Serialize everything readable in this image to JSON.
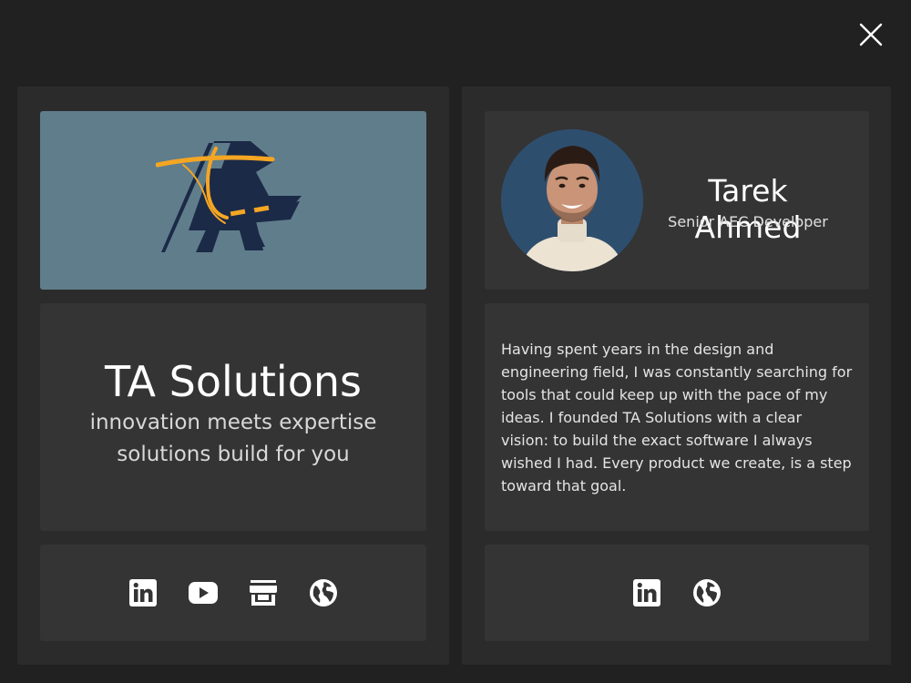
{
  "window": {
    "close_icon": "close-icon"
  },
  "company": {
    "logo_icon": "ta-solutions-logo",
    "logo_text": "TA",
    "name": "TA Solutions",
    "tagline_line1": "innovation meets expertise",
    "tagline_line2": "solutions build for you",
    "links": [
      {
        "icon": "linkedin-icon"
      },
      {
        "icon": "youtube-icon"
      },
      {
        "icon": "store-icon"
      },
      {
        "icon": "globe-icon"
      }
    ]
  },
  "person": {
    "name": "Tarek Ahmed",
    "role": "Senior AEC Developer",
    "bio": "Having spent years in the design and engineering field, I was constantly searching for tools that could keep up with the pace of my ideas. I founded TA Solutions with a clear vision: to build the exact software I always wished I had. Every product we create, is a step toward that goal.",
    "links": [
      {
        "icon": "linkedin-icon"
      },
      {
        "icon": "globe-icon"
      }
    ]
  },
  "colors": {
    "background": "#212121",
    "panel": "#2b2b2b",
    "card": "#343434",
    "logo_bg": "#607d8b",
    "logo_navy": "#1b2a47",
    "logo_orange": "#f5a623"
  }
}
